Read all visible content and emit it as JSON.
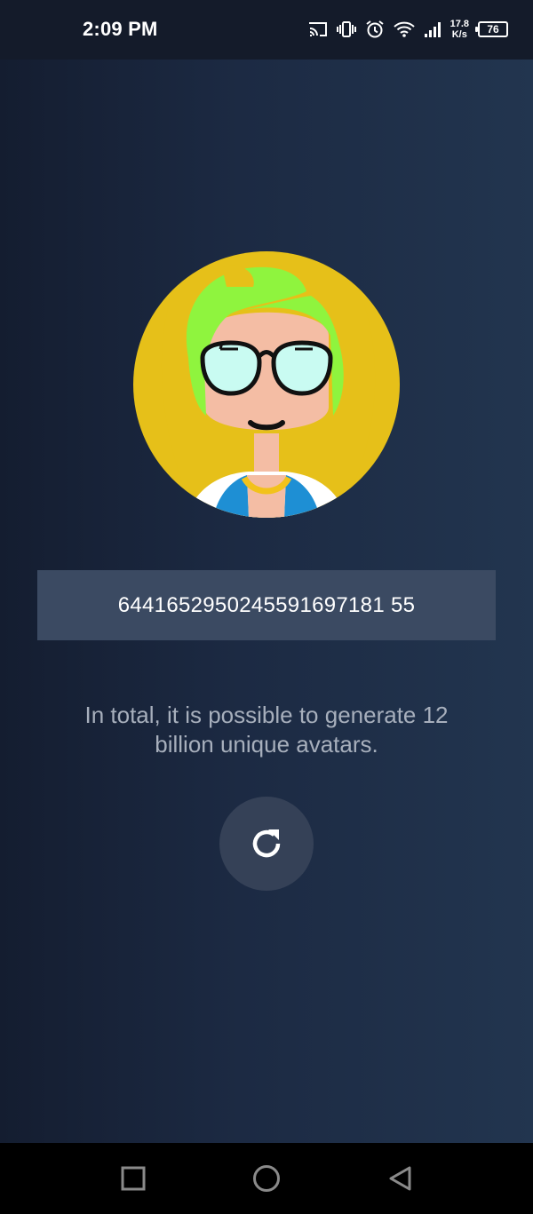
{
  "status_bar": {
    "time": "2:09 PM",
    "net_speed_value": "17.8",
    "net_speed_unit": "K/s",
    "battery": "76",
    "icons": [
      "cast-icon",
      "vibrate-icon",
      "alarm-icon",
      "wifi-icon",
      "signal-icon",
      "battery-icon"
    ]
  },
  "avatar": {
    "hair_color": "#e6c019",
    "top_color": "#8ff43e",
    "skin_color": "#f4bda4",
    "lens_color": "#c9fbf2",
    "shirt_color": "#1e8fd4",
    "necklace_color": "#f2c21b"
  },
  "avatar_id": "6441652950245591697181 55",
  "info_text": "In total, it is possible to generate 12 billion unique avatars.",
  "refresh": {
    "icon": "refresh-icon"
  },
  "nav_bar": {
    "icons": [
      "recents-icon",
      "home-icon",
      "back-icon"
    ]
  },
  "colors": {
    "background_left": "#141d30",
    "background_right": "#22354f",
    "id_box": "#3b4a62",
    "refresh_button": "#354157",
    "info_text": "#a7afbc"
  }
}
